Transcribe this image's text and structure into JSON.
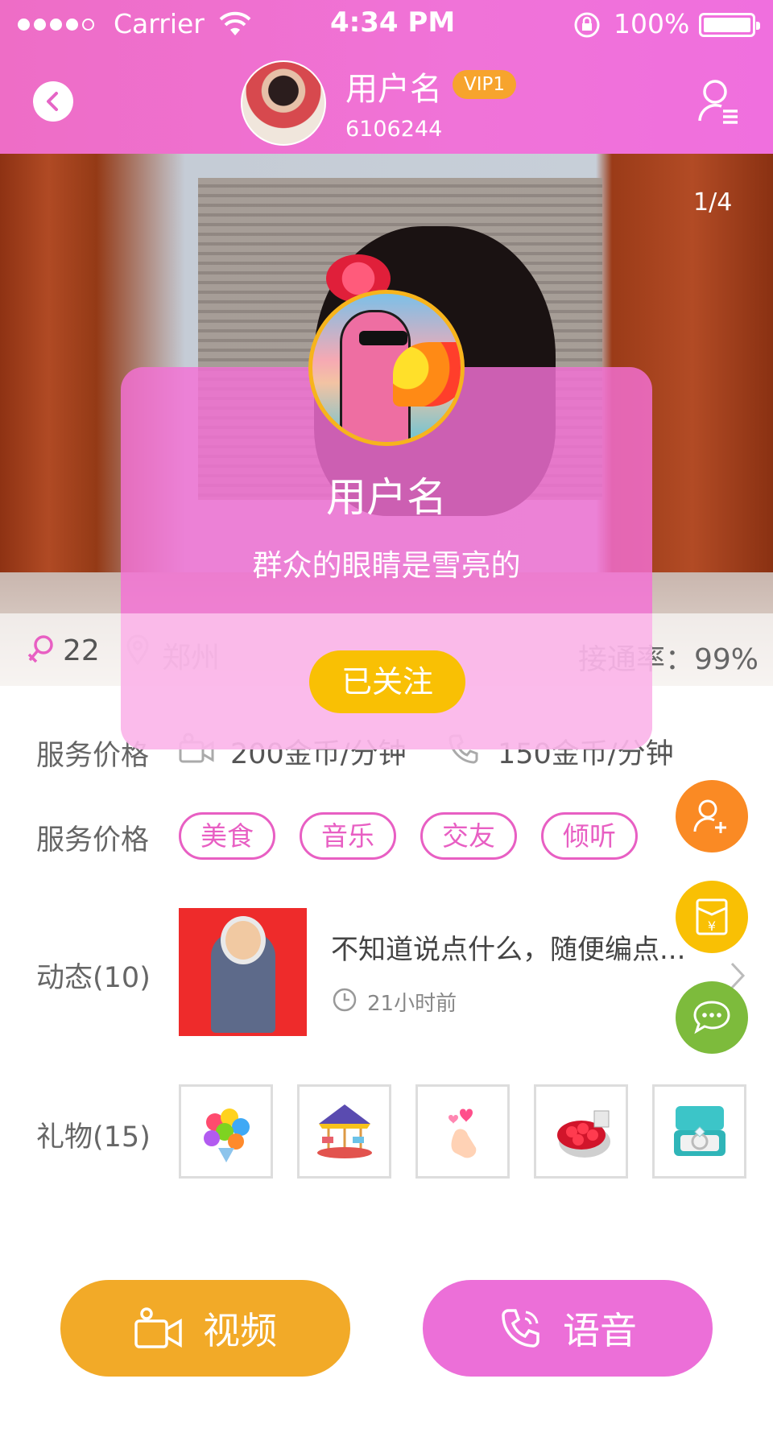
{
  "status_bar": {
    "carrier": "Carrier",
    "time": "4:34 PM",
    "battery": "100%"
  },
  "header": {
    "username": "用户名",
    "vip": "VIP1",
    "user_id": "6106244"
  },
  "photo": {
    "counter": "1/4"
  },
  "info": {
    "age": "22",
    "city": "郑州",
    "connect_rate": "接通率：99%"
  },
  "service": {
    "label": "服务价格",
    "video_price": "200金币/分钟",
    "voice_price": "150金币/分钟"
  },
  "tags": {
    "label": "服务价格",
    "items": [
      "美食",
      "音乐",
      "交友",
      "倾听"
    ]
  },
  "feed": {
    "label": "动态(10)",
    "text": "不知道说点什么，随便编点...",
    "time": "21小时前"
  },
  "gifts": {
    "label": "礼物(15)",
    "items": [
      "rainbow-rose-bouquet",
      "carousel",
      "finger-heart",
      "red-rose-box",
      "diamond-ring"
    ]
  },
  "popup": {
    "name": "用户名",
    "bio": "群众的眼睛是雪亮的",
    "follow_label": "已关注"
  },
  "actions": {
    "video_label": "视频",
    "voice_label": "语音"
  },
  "colors": {
    "pink": "#f070d8",
    "orange": "#f7a42d",
    "yellow": "#f9c004",
    "green": "#7dbb3c",
    "fab_orange": "#fa8a24"
  }
}
